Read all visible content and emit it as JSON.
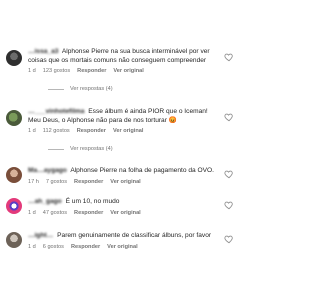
{
  "comments": [
    {
      "username": "…issa_a3",
      "text": "Alphonse Pierre na sua busca interminável por ver coisas que os mortais comuns não conseguem compreender",
      "time": "1 d",
      "likes": "123 gostos",
      "reply_label": "Responder",
      "translate_label": "Ver original",
      "replies_label": "Ver respostas (4)"
    },
    {
      "username": "…___vinhotefilma",
      "text": "Esse álbum é ainda PIOR que o Iceman! Meu Deus, o Alphonse não para de nos torturar",
      "emoji": "😡",
      "time": "1 d",
      "likes": "112 gostos",
      "reply_label": "Responder",
      "translate_label": "Ver original",
      "replies_label": "Ver respostas (4)"
    },
    {
      "username": "Ma…aygago",
      "text": "Alphonse Pierre na folha de pagamento da OVO.",
      "time": "17 h",
      "likes": "7 gostos",
      "reply_label": "Responder",
      "translate_label": "Ver original"
    },
    {
      "username": "…ah_gago",
      "text": "É um 10, no mudo",
      "time": "1 d",
      "likes": "47 gostos",
      "reply_label": "Responder",
      "translate_label": "Ver original"
    },
    {
      "username": "…ight…",
      "text": "Parem genuinamente de classificar álbuns, por favor",
      "time": "1 d",
      "likes": "6 gostos",
      "reply_label": "Responder",
      "translate_label": "Ver original"
    }
  ]
}
